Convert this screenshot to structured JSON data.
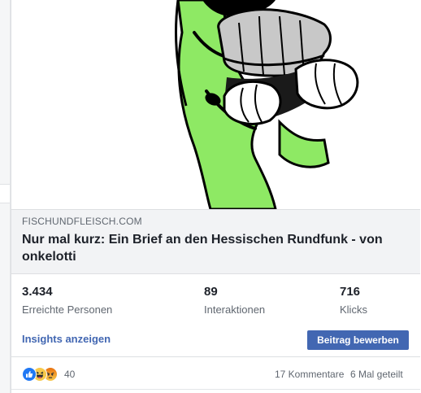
{
  "link_preview": {
    "domain": "FISCHUNDFLEISCH.COM",
    "title": "Nur mal kurz: Ein Brief an den Hessischen Rundfunk - von onkelotti"
  },
  "stats": [
    {
      "value": "3.434",
      "label": "Erreichte Personen"
    },
    {
      "value": "89",
      "label": "Interaktionen"
    },
    {
      "value": "716",
      "label": "Klicks"
    }
  ],
  "actions": {
    "insights_label": "Insights anzeigen",
    "boost_label": "Beitrag bewerben"
  },
  "footer": {
    "reactions": [
      "like-icon",
      "haha-icon",
      "angry-icon"
    ],
    "reaction_count": "40",
    "comments": "17 Kommentare",
    "shares": "6 Mal geteilt"
  },
  "colors": {
    "accent": "#4267b2",
    "character_green": "#8ee964",
    "like_blue": "#2078f4",
    "emoji_yellow": "#f7c94b",
    "angry_red": "#e9710f"
  }
}
